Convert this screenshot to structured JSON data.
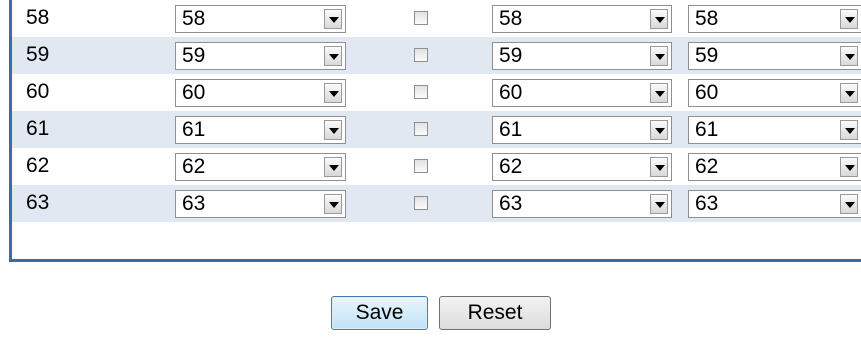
{
  "rows": [
    {
      "label": "58",
      "select1": "58",
      "select2": "58",
      "select3": "58",
      "checked": false
    },
    {
      "label": "59",
      "select1": "59",
      "select2": "59",
      "select3": "59",
      "checked": false
    },
    {
      "label": "60",
      "select1": "60",
      "select2": "60",
      "select3": "60",
      "checked": false
    },
    {
      "label": "61",
      "select1": "61",
      "select2": "61",
      "select3": "61",
      "checked": false
    },
    {
      "label": "62",
      "select1": "62",
      "select2": "62",
      "select3": "62",
      "checked": false
    },
    {
      "label": "63",
      "select1": "63",
      "select2": "63",
      "select3": "63",
      "checked": false
    }
  ],
  "buttons": {
    "save_label": "Save",
    "reset_label": "Reset"
  },
  "colors": {
    "row_alt": "#e1e8f1",
    "table_border": "#3f6aa6",
    "save_button_border": "#3c7fb1"
  }
}
